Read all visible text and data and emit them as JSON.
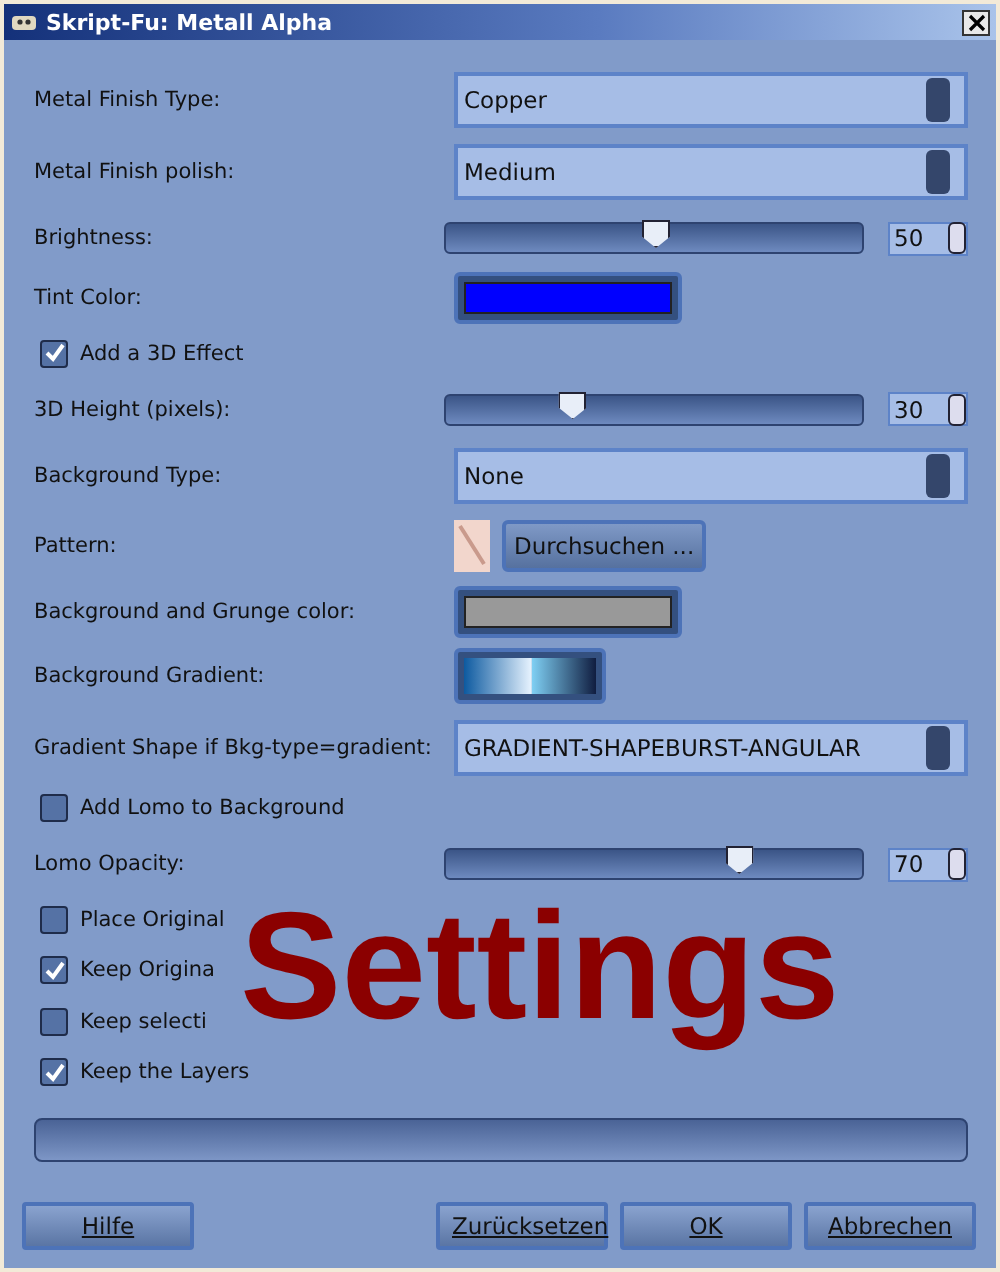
{
  "window": {
    "title": "Skript-Fu: Metall Alpha"
  },
  "fields": [
    {
      "kind": "combo",
      "label": "Metal Finish Type:",
      "value": "Copper"
    },
    {
      "kind": "combo",
      "label": "Metal Finish polish:",
      "value": "Medium"
    },
    {
      "kind": "slider",
      "label": "Brightness:",
      "level": 0.5,
      "reading": "50"
    },
    {
      "kind": "color",
      "label": "Tint Color:",
      "color": "#0000ff"
    },
    {
      "kind": "check",
      "label": "Add a 3D Effect",
      "checked": true
    },
    {
      "kind": "slider",
      "label": "3D Height (pixels):",
      "level": 0.3,
      "reading": "30"
    },
    {
      "kind": "combo",
      "label": "Background Type:",
      "value": "None"
    },
    {
      "kind": "pattern",
      "label": "Pattern:",
      "button": "Durchsuchen ..."
    },
    {
      "kind": "color",
      "label": "Background and Grunge color:",
      "color": "#999999"
    },
    {
      "kind": "gradient",
      "label": "Background Gradient:"
    },
    {
      "kind": "combo",
      "label": "Gradient Shape if Bkg-type=gradient:",
      "value": "GRADIENT-SHAPEBURST-ANGULAR"
    },
    {
      "kind": "check",
      "label": "Add Lomo to Background",
      "checked": false
    },
    {
      "kind": "slider",
      "label": "Lomo Opacity:",
      "level": 0.7,
      "reading": "70"
    },
    {
      "kind": "check",
      "label": "Place Original",
      "checked": false
    },
    {
      "kind": "check",
      "label": "Keep Origina",
      "checked": true
    },
    {
      "kind": "check",
      "label": "Keep selecti",
      "checked": false
    },
    {
      "kind": "check",
      "label": "Keep the Layers",
      "checked": true
    }
  ],
  "progress": {
    "level": 0
  },
  "overlay_caption": "Settings",
  "buttons": [
    {
      "label": "Hilfe"
    },
    {
      "label": "Zurücksetzen"
    },
    {
      "label": "OK"
    },
    {
      "label": "Abbrechen"
    }
  ]
}
